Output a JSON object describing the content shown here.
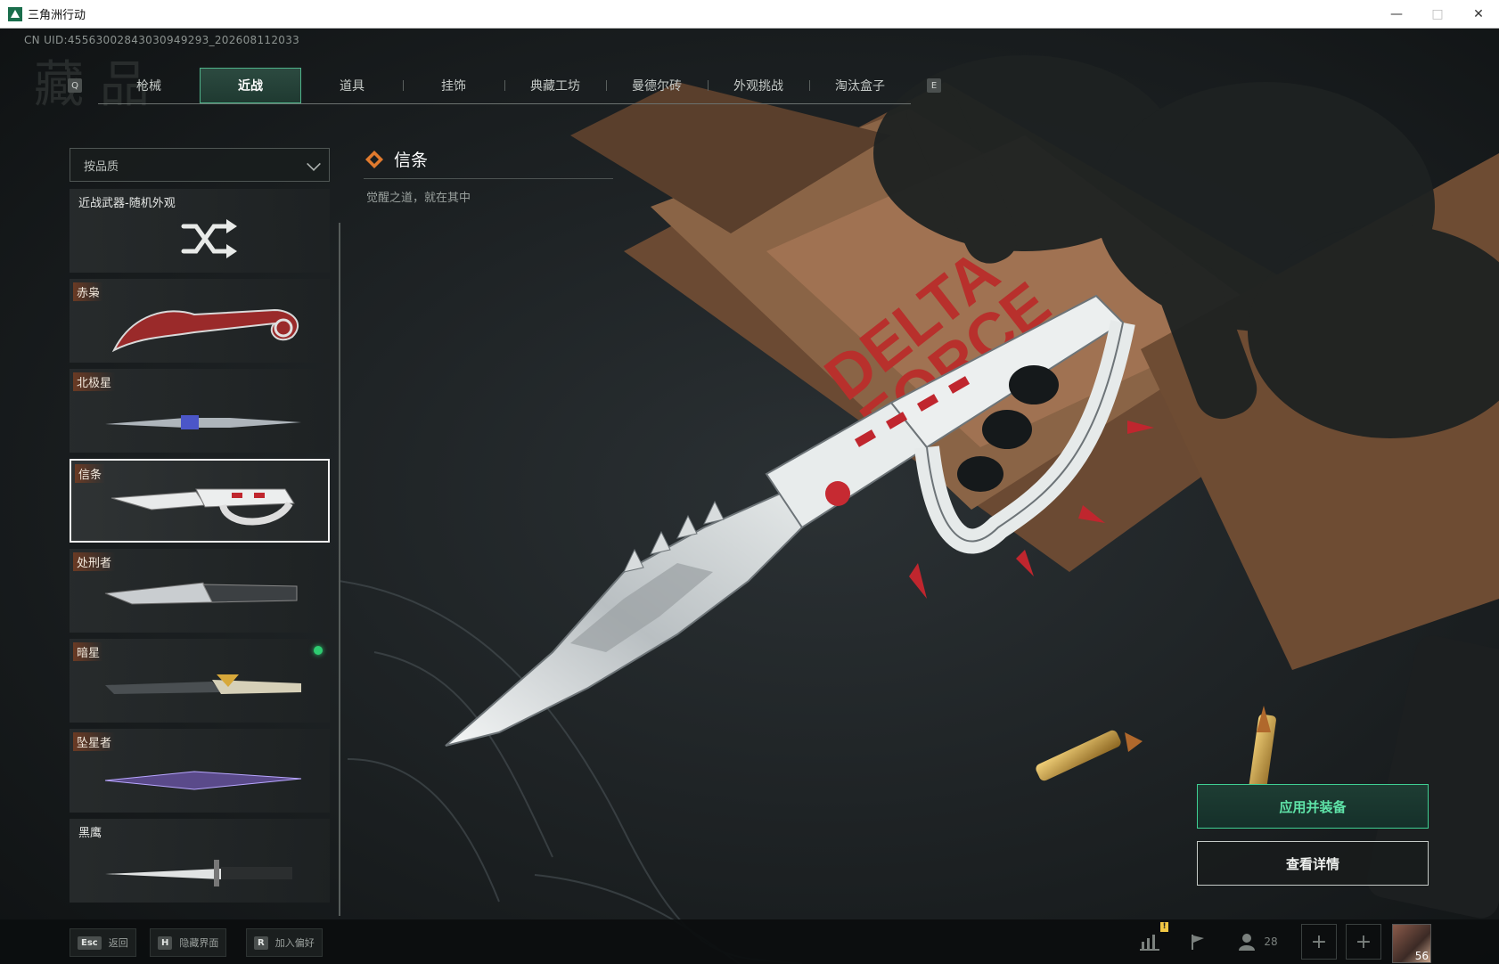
{
  "window": {
    "title": "三角洲行动",
    "controls": [
      "minimize-icon",
      "maximize-icon",
      "close-icon"
    ]
  },
  "uid": "CN UID:455630028430309492­93_202608112033",
  "tabs": {
    "prev_key": "Q",
    "next_key": "E",
    "items": [
      {
        "label": "枪械",
        "active": false
      },
      {
        "label": "近战",
        "active": true
      },
      {
        "label": "道具",
        "active": false
      },
      {
        "label": "挂饰",
        "active": false
      },
      {
        "label": "典藏工坊",
        "active": false
      },
      {
        "label": "曼德尔砖",
        "active": false
      },
      {
        "label": "外观挑战",
        "active": false
      },
      {
        "label": "淘汰盒子",
        "active": false
      }
    ]
  },
  "filter": {
    "label": "按品质"
  },
  "list": {
    "items": [
      {
        "label": "近战武器-随机外观",
        "icon": "shuffle-icon",
        "selected": false
      },
      {
        "label": "赤枭",
        "selected": false
      },
      {
        "label": "北极星",
        "selected": false
      },
      {
        "label": "信条",
        "selected": true
      },
      {
        "label": "处刑者",
        "selected": false
      },
      {
        "label": "暗星",
        "selected": false,
        "equipped": true
      },
      {
        "label": "坠星者",
        "selected": false
      },
      {
        "label": "黑鹰",
        "selected": false
      }
    ]
  },
  "detail": {
    "name": "信条",
    "description": "觉醒之道，就在其中",
    "quality_color": "#e07a2e"
  },
  "actions": {
    "primary_label": "应用并装备",
    "secondary_label": "查看详情"
  },
  "bottombar": {
    "hints": [
      {
        "key": "Esc",
        "label": "返回"
      },
      {
        "key": "H",
        "label": "隐藏界面"
      },
      {
        "key": "R",
        "label": "加入偏好"
      }
    ],
    "friends_count": "28",
    "level": "56"
  },
  "colors": {
    "accent_green": "#3fcf93",
    "quality_orange": "#6a3a24"
  }
}
